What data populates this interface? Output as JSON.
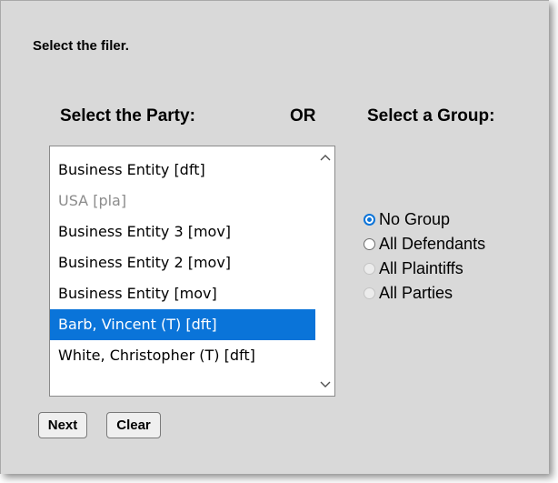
{
  "form": {
    "instruction": "Select the filer.",
    "party_heading": "Select the Party:",
    "or_label": "OR",
    "group_heading": "Select a Group:"
  },
  "party_list": {
    "items": [
      {
        "label": "Business Entity [dft]",
        "state": "normal"
      },
      {
        "label": "USA [pla]",
        "state": "disabled"
      },
      {
        "label": "Business Entity 3 [mov]",
        "state": "normal"
      },
      {
        "label": "Business Entity 2 [mov]",
        "state": "normal"
      },
      {
        "label": "Business Entity [mov]",
        "state": "normal"
      },
      {
        "label": "Barb, Vincent (T) [dft]",
        "state": "selected"
      },
      {
        "label": "White, Christopher (T) [dft]",
        "state": "normal"
      }
    ],
    "scroll_up_icon": "chevron-up-icon",
    "scroll_down_icon": "chevron-down-icon"
  },
  "group_options": [
    {
      "label": "No Group",
      "checked": true,
      "enabled": true
    },
    {
      "label": "All Defendants",
      "checked": false,
      "enabled": true
    },
    {
      "label": "All Plaintiffs",
      "checked": false,
      "enabled": false
    },
    {
      "label": "All Parties",
      "checked": false,
      "enabled": false
    }
  ],
  "buttons": {
    "next": "Next",
    "clear": "Clear"
  },
  "colors": {
    "selection": "#0a74d9",
    "panel_background": "#d9d9d9",
    "disabled_text": "#8c8c8c"
  }
}
